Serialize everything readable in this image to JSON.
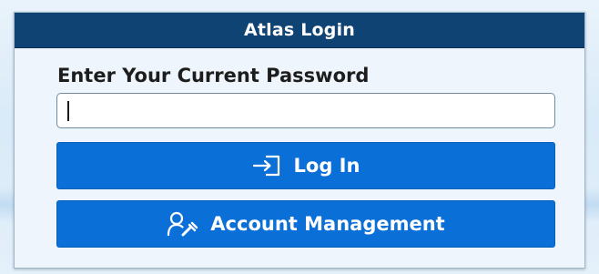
{
  "dialog": {
    "title": "Atlas Login",
    "prompt": "Enter Your Current Password",
    "password": {
      "value": "",
      "placeholder": ""
    },
    "login_button": {
      "label": "Log In",
      "icon": "sign-in-icon"
    },
    "account_button": {
      "label": "Account Management",
      "icon": "user-manage-icon"
    }
  },
  "colors": {
    "title_bar": "#0e4373",
    "button": "#0a6fd6",
    "dialog_bg": "#eff5fc"
  }
}
